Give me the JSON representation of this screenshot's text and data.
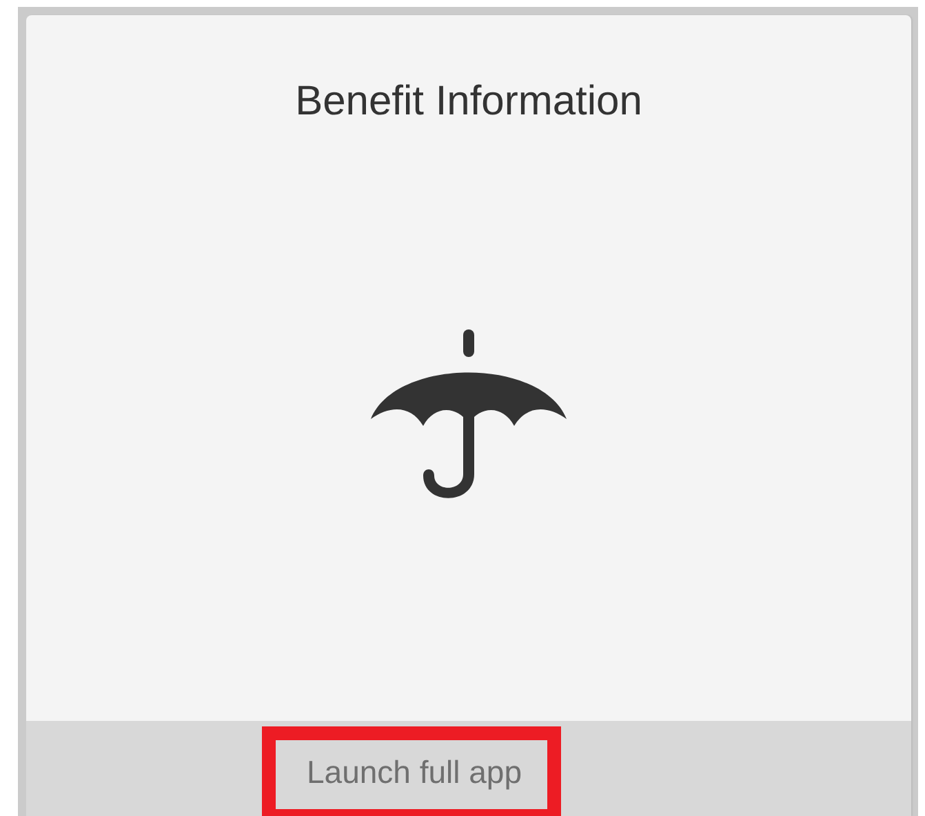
{
  "card": {
    "title": "Benefit Information",
    "footer": {
      "link": "Launch full app",
      "highlighted": true
    }
  }
}
